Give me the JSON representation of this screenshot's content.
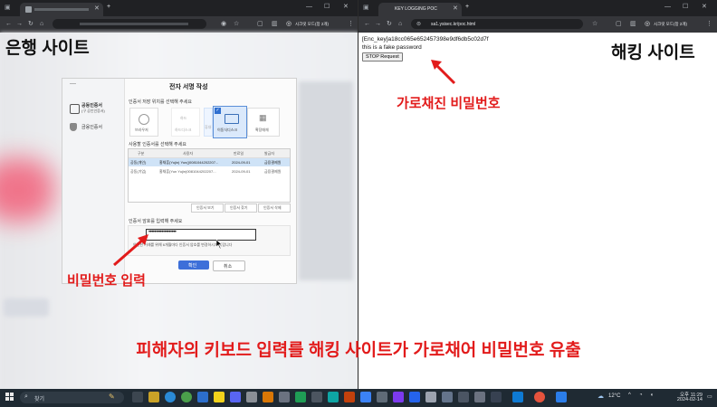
{
  "left_browser": {
    "window_controls": [
      "—",
      "☐",
      "✕"
    ],
    "toolbar_chip": "시크릿 모드(창 2개)",
    "overlay_label": "은행 사이트",
    "dialog": {
      "title": "전자 서명 작성",
      "side_menu": [
        {
          "label": "공동인증서",
          "sub": "(구 공인인증서)"
        },
        {
          "label": "금융인증서",
          "sub": ""
        }
      ],
      "location_prompt": "인증서 저장 위치를 선택해 주세요",
      "locations": [
        {
          "label": "브라우저",
          "selected": false
        },
        {
          "label": "하드",
          "sub": "하드디스크",
          "selected": false
        },
        {
          "label": "휴대전화",
          "selected": false
        },
        {
          "label": "이동식디스크",
          "selected": true
        },
        {
          "label": "확장매체",
          "selected": false
        }
      ],
      "cert_prompt": "사용할 인증서를 선택해 주세요",
      "table_headers": [
        "구분",
        "사용자",
        "만료일",
        "발급자"
      ],
      "rows": [
        {
          "type": "공동(개인)",
          "user": "홍채훈(Yujin) Yun()0081044202207...",
          "expiry": "2024-09-01",
          "issuer": "금융결제원",
          "selected": true
        },
        {
          "type": "공동(기업)",
          "user": "홍채훈(Yun Yujin)0081044202207...",
          "expiry": "2024-09-01",
          "issuer": "금융결제원",
          "selected": false
        }
      ],
      "cert_buttons": [
        "인증서 보기",
        "인증서 찾기",
        "인증서 삭제"
      ],
      "password_prompt": "인증서 암호를 입력해 주세요",
      "password_value": "•••••••••••••••••••",
      "password_note": "안전한 거래를 위해 6개월마다 인증서 암호를 변경하시기 바랍니다",
      "confirm_label": "확인",
      "cancel_label": "취소"
    },
    "annotation_password_input": "비밀번호 입력"
  },
  "right_browser": {
    "tab_title": "KEY LOGGING POC",
    "url": "sa1.ysisec.kr/poc.html",
    "toolbar_chip": "시크릿 모드(창 2개)",
    "window_controls": [
      "—",
      "☐",
      "✕"
    ],
    "enc_key_line": "[Enc_key]a18cc065e652457398e9df6db5c02d7f",
    "captured_text": "this is a fake password",
    "stop_button": "STOP Request",
    "overlay_label": "해킹 사이트",
    "annotation_intercepted": "가로채진 비밀번호"
  },
  "caption": "피해자의 키보드 입력를 해킹 사이트가 가로채어 비밀번호 유출",
  "taskbar": {
    "search_label": "찾기",
    "temperature": "12°C",
    "time": "오후 11:29",
    "date": "2024-02-14"
  },
  "colors": {
    "annotation_red": "#e21b1b",
    "selection_blue": "#cfe3f7",
    "confirm_blue": "#3d6fd9"
  }
}
